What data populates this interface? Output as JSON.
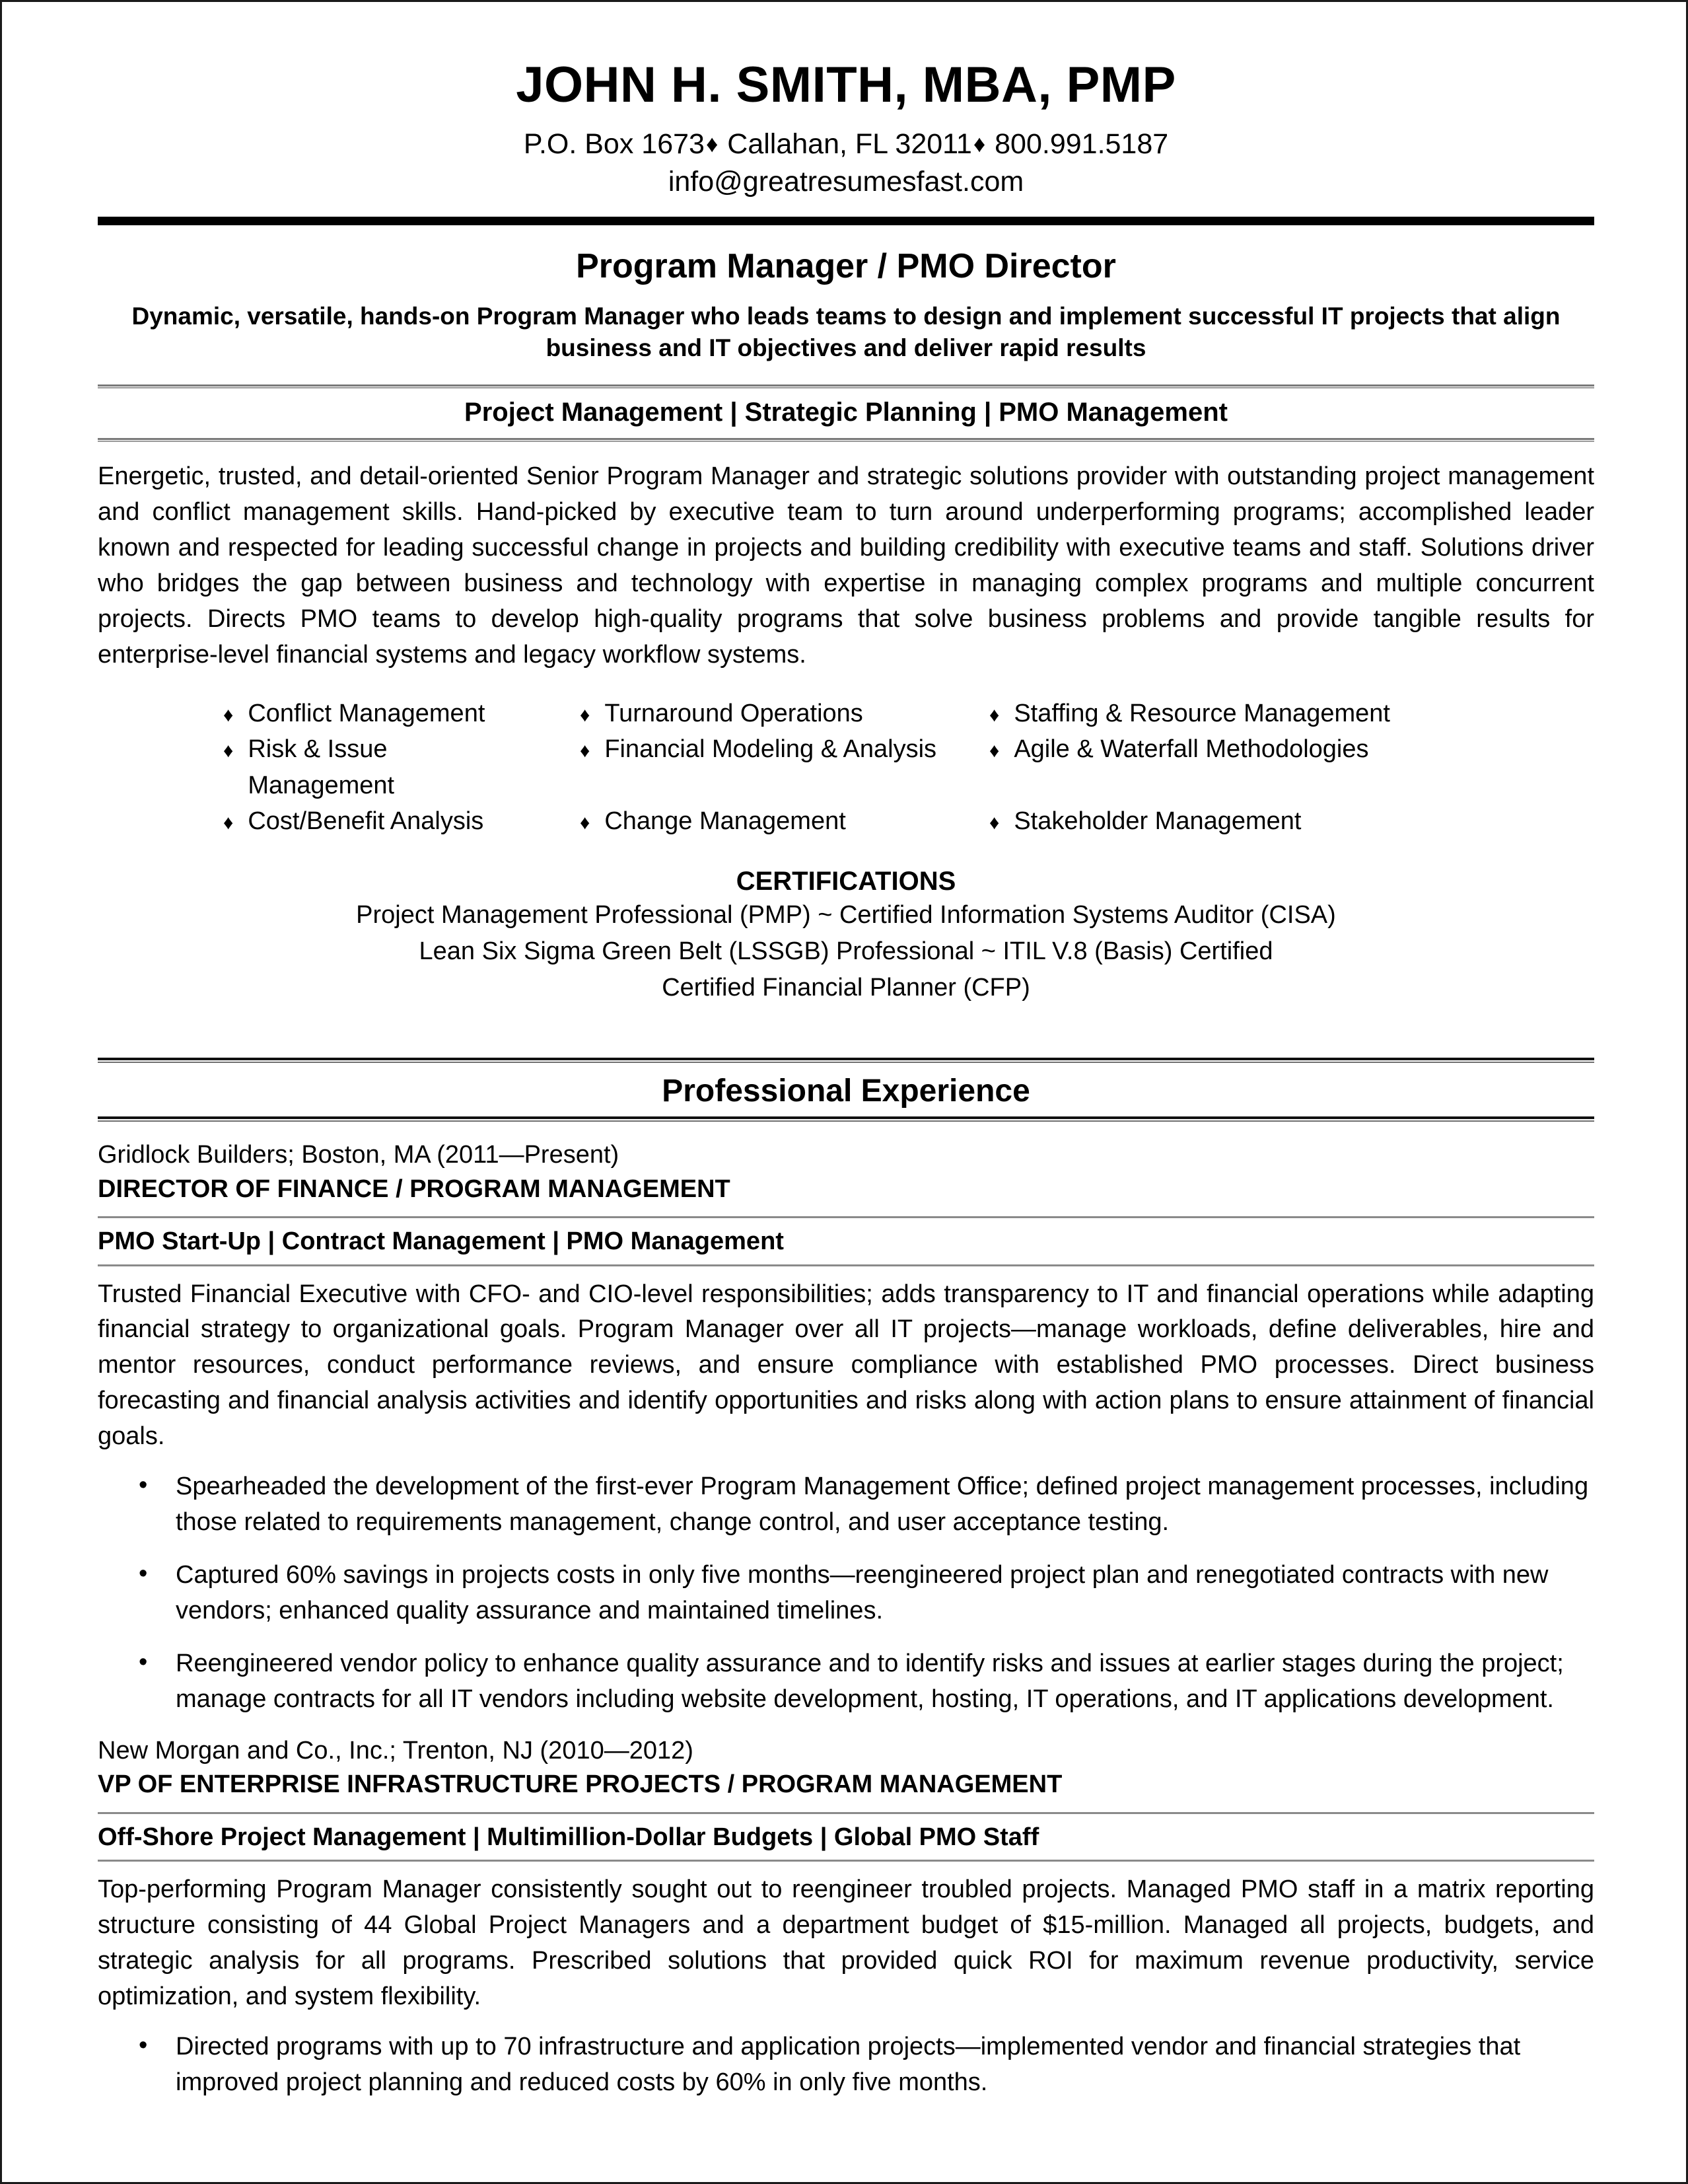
{
  "header": {
    "name": "JOHN H. SMITH, MBA, PMP",
    "address_part1": "P.O. Box 1673",
    "address_sep1": "♦",
    "address_part2": " Callahan, FL 32011",
    "address_sep2": "♦",
    "address_part3": " 800.991.5187",
    "email": "info@greatresumesfast.com"
  },
  "target": {
    "title": "Program Manager / PMO Director",
    "tagline": "Dynamic, versatile, hands-on Program Manager who leads teams to design and implement successful IT projects that align business and IT objectives and deliver rapid results",
    "keywords": "Project Management | Strategic Planning | PMO Management"
  },
  "summary": {
    "text": "Energetic, trusted, and detail-oriented Senior Program Manager and strategic solutions provider with outstanding project management and conflict management skills.  Hand-picked by executive team to turn around underperforming programs; accomplished leader known and respected for leading successful change in projects and building credibility with executive teams and staff.  Solutions driver who bridges the gap between business and technology with expertise in managing complex programs and multiple concurrent projects.  Directs PMO teams to develop high-quality programs that solve business problems and provide tangible results for enterprise-level financial systems and legacy workflow systems."
  },
  "skills": {
    "bullet_glyph": "♦",
    "items": [
      "Conflict Management",
      "Turnaround Operations",
      "Staffing & Resource Management",
      "Risk & Issue Management",
      "Financial Modeling & Analysis",
      "Agile & Waterfall Methodologies",
      "Cost/Benefit Analysis",
      "Change Management",
      "Stakeholder Management"
    ]
  },
  "certifications": {
    "heading": "CERTIFICATIONS",
    "lines": [
      "Project Management Professional (PMP) ~ Certified Information Systems Auditor (CISA)",
      "Lean Six Sigma Green Belt (LSSGB) Professional ~ ITIL V.8 (Basis) Certified",
      "Certified Financial Planner (CFP)"
    ]
  },
  "experience": {
    "section_heading": "Professional Experience",
    "jobs": [
      {
        "company": "Gridlock Builders; Boston, MA (2011—Present)",
        "title": "DIRECTOR OF FINANCE / PROGRAM MANAGEMENT",
        "keywords": "PMO Start-Up | Contract Management | PMO Management",
        "description": "Trusted Financial Executive with CFO- and CIO-level responsibilities; adds transparency to IT and financial operations while adapting financial strategy to organizational goals.  Program Manager over all IT projects—manage workloads, define deliverables, hire and mentor resources, conduct performance reviews, and ensure compliance with established PMO processes.   Direct business forecasting and financial analysis activities and identify opportunities and risks along with action plans to ensure attainment of financial goals.",
        "bullet_glyph": "•",
        "achievements": [
          "Spearheaded the development of the first-ever Program Management Office; defined project management processes, including those related to requirements management, change control, and user acceptance testing.",
          "Captured 60% savings in projects costs in only five months—reengineered project plan and renegotiated contracts with new vendors; enhanced quality assurance and maintained timelines.",
          "Reengineered vendor policy to enhance quality assurance and to identify risks and issues at earlier stages during the project; manage contracts for all IT vendors including website development, hosting, IT operations, and IT applications development."
        ]
      },
      {
        "company": "New Morgan and Co., Inc.; Trenton, NJ (2010—2012)",
        "title": "VP OF ENTERPRISE INFRASTRUCTURE PROJECTS / PROGRAM MANAGEMENT",
        "keywords": "Off-Shore Project Management | Multimillion-Dollar Budgets | Global PMO Staff",
        "description": "Top-performing Program Manager consistently sought out to reengineer troubled projects.  Managed PMO staff in a matrix reporting structure consisting of 44 Global Project Managers and a department budget of $15-million. Managed all projects, budgets, and strategic analysis for all programs.   Prescribed solutions that provided quick ROI for maximum revenue productivity, service optimization, and system flexibility.",
        "bullet_glyph": "•",
        "achievements": [
          "Directed programs with up to 70 infrastructure and application projects—implemented vendor and financial strategies that improved project planning and reduced costs by 60% in only five months."
        ]
      }
    ]
  }
}
